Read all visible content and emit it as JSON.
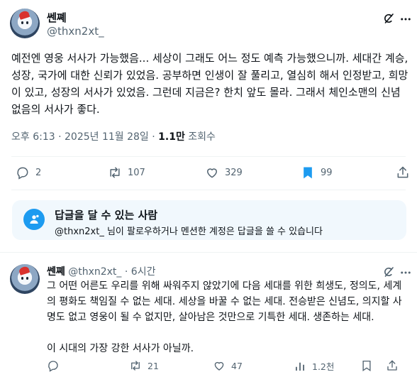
{
  "tweet": {
    "author": "쎈쪠",
    "handle": "@thxn2xt_",
    "text": "예전엔 영웅 서사가 가능했음... 세상이 그래도 어느 정도 예측 가능했으니까. 세대간 계승, 성장, 국가에 대한 신뢰가 있었음. 공부하면 인생이 잘 풀리고, 열심히 해서 인정받고, 희망이 있고, 성장의 서사가 있었음. 그런데 지금은? 한치 앞도 몰라. 그래서 체인소맨의 신념 없음의 서사가 좋다.",
    "time": "오후 6:13 · 2025년 11월 28일 · ",
    "views": "1.1만",
    "views_label": " 조회수",
    "stats": {
      "replies": "2",
      "reposts": "107",
      "likes": "329",
      "bookmarks": "99"
    }
  },
  "reply_restriction": {
    "title": "답글을 달 수 있는 사람",
    "description": "@thxn2xt_ 님이 팔로우하거나 멘션한 계정은 답글을 쓸 수 있습니다"
  },
  "reply": {
    "author": "쎈쪠",
    "handle": "@thxn2xt_",
    "time": "6시간",
    "separator": " · ",
    "text": "그 어떤 어른도 우리를 위해 싸워주지 않았기에 다음 세대를 위한 희생도, 정의도, 세계의 평화도 책임질 수 없는 세대. 세상을 바꿀 수 없는 세대. 전승받은 신념도, 의지할 사명도 없고 영웅이 될 수 없지만, 살아남은 것만으로 기특한 세대. 생존하는 세대.\n\n이 시대의 가장 강한 서사가 아닐까.",
    "stats": {
      "replies": "",
      "reposts": "21",
      "likes": "47",
      "views": "1.2천"
    }
  },
  "colors": {
    "accent": "#1d9bf0",
    "text": "#0f1419",
    "muted": "#536471",
    "divider": "#eff3f4",
    "reply_box_bg": "#f1f8fd"
  },
  "icons": [
    "grok-icon",
    "more-icon",
    "reply-icon",
    "repost-icon",
    "like-icon",
    "bookmark-icon",
    "share-icon",
    "people-icon",
    "views-icon"
  ]
}
